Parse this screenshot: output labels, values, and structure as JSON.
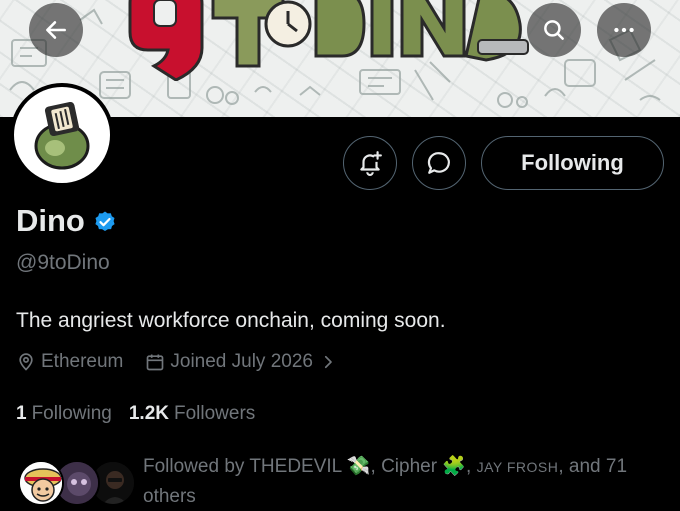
{
  "banner": {
    "logo_text": "9toDINO"
  },
  "topbar": {
    "back_icon": "arrow-left-icon",
    "search_icon": "search-icon",
    "more_icon": "more-horizontal-icon"
  },
  "actions": {
    "notify_icon": "bell-plus-icon",
    "message_icon": "message-bubble-icon",
    "follow_label": "Following"
  },
  "profile": {
    "name": "Dino",
    "handle": "@9toDino",
    "bio": "The angriest workforce onchain, coming soon.",
    "location": "Ethereum",
    "joined": "Joined July 2026",
    "colors": {
      "verified": "#1d9bf0",
      "muted": "#71767b",
      "text": "#e7e9ea",
      "border": "#536471"
    }
  },
  "stats": {
    "following_count": "1",
    "following_label": "Following",
    "followers_count": "1.2K",
    "followers_label": "Followers"
  },
  "followed_by": {
    "prefix": "Followed by",
    "user1": "THEDEVIL",
    "user2": "Cipher",
    "user3": "JAY FROSH",
    "suffix": "and 71 others"
  }
}
